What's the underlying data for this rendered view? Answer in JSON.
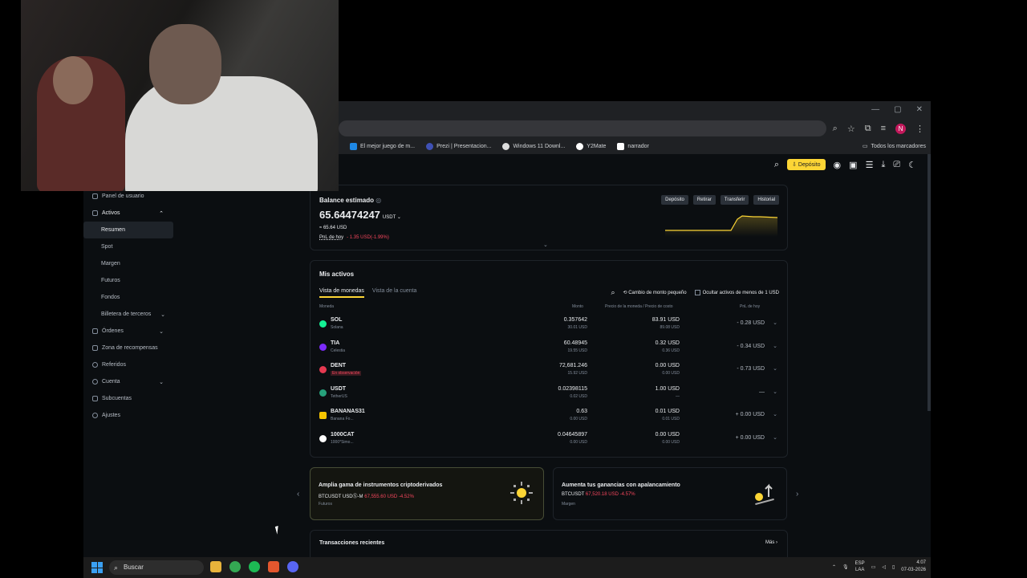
{
  "browser": {
    "bookmarks": [
      {
        "label": "El mejor juego de m...",
        "color": "#1e88e5"
      },
      {
        "label": "Prezi | Presentacion...",
        "color": "#3f51b5"
      },
      {
        "label": "Windows 11 Downl...",
        "color": "#f5f5f5"
      },
      {
        "label": "Y2Mate",
        "color": "#ffffff"
      },
      {
        "label": "narrador",
        "color": "#ffffff"
      }
    ],
    "all_bookmarks": "Todos los marcadores",
    "profile_initial": "N"
  },
  "topnav": {
    "deposit": "Depósito"
  },
  "sidebar": {
    "panel": "Panel de usuario",
    "activos": "Activos",
    "sub": [
      "Resumen",
      "Spot",
      "Margen",
      "Futuros",
      "Fondos",
      "Billetera de terceros"
    ],
    "rest": [
      "Órdenes",
      "Zona de recompensas",
      "Referidos",
      "Cuenta",
      "Subcuentas",
      "Ajustes"
    ]
  },
  "balance": {
    "label": "Balance estimado",
    "amount": "65.64474247",
    "currency": "USDT",
    "usd": "≈ 65.64 USD",
    "pnl_label": "PnL de hoy",
    "pnl_value": "- 1.35 USD(-1.99%)",
    "buttons": [
      "Depósito",
      "Retirar",
      "Transferir",
      "Historial"
    ]
  },
  "assets": {
    "title": "Mis activos",
    "tabs": [
      "Vista de monedas",
      "Vista de la cuenta"
    ],
    "small_change": "Cambio de monto pequeño",
    "hide_small": "Ocultar activos de menos de 1 USD",
    "headers": [
      "Moneda",
      "Monto",
      "Precio de la moneda / Precio de costo",
      "PnL de hoy"
    ],
    "rows": [
      {
        "sym": "SOL",
        "name": "Solana",
        "amount": "0.357642",
        "amount_usd": "30.01 USD",
        "price": "83.91 USD",
        "cost": "89.08 USD",
        "pnl": "- 0.28 USD",
        "color": "#14f195"
      },
      {
        "sym": "TIA",
        "name": "Celestia",
        "amount": "60.48945",
        "amount_usd": "19.55 USD",
        "price": "0.32 USD",
        "cost": "0.36 USD",
        "pnl": "- 0.34 USD",
        "color": "#7b2bf9"
      },
      {
        "sym": "DENT",
        "name": "En observación",
        "amount": "72,681.246",
        "amount_usd": "15.92 USD",
        "price": "0.00 USD",
        "cost": "0.00 USD",
        "pnl": "- 0.73 USD",
        "color": "#e53950"
      },
      {
        "sym": "USDT",
        "name": "TetherUS",
        "amount": "0.02398115",
        "amount_usd": "0.02 USD",
        "price": "1.00 USD",
        "cost": "—",
        "pnl": "—",
        "color": "#26a17b"
      },
      {
        "sym": "BANANAS31",
        "name": "Banana Fo...",
        "amount": "0.63",
        "amount_usd": "0.00 USD",
        "price": "0.01 USD",
        "cost": "0.01 USD",
        "pnl": "+ 0.00 USD",
        "color": "#f5c400"
      },
      {
        "sym": "1000CAT",
        "name": "1000*Simo...",
        "amount": "0.04645897",
        "amount_usd": "0.00 USD",
        "price": "0.00 USD",
        "cost": "0.00 USD",
        "pnl": "+ 0.00 USD",
        "color": "#ffffff"
      }
    ]
  },
  "promos": [
    {
      "title": "Amplia gama de instrumentos criptoderivados",
      "pair": "BTCUSDT USDⓈ-M",
      "quote": "67,555.60 USD -4.52%",
      "category": "Futuros"
    },
    {
      "title": "Aumenta tus ganancias con apalancamiento",
      "pair": "BTCUSDT",
      "quote": "67,520.18 USD -4.57%",
      "category": "Margen"
    }
  ],
  "recent": {
    "title": "Transacciones recientes",
    "more": "Más"
  },
  "taskbar": {
    "search": "Buscar",
    "lang1": "ESP",
    "lang2": "LAA",
    "time": "4:07",
    "date": "07-03-2026"
  }
}
